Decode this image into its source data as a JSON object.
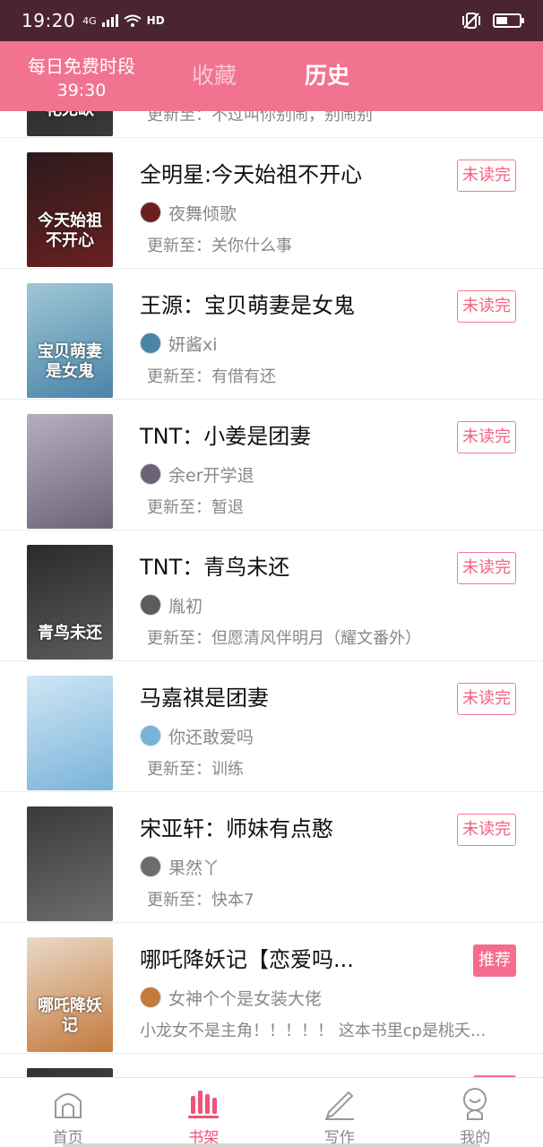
{
  "status_bar": {
    "time": "19:20",
    "network": "4G",
    "hd": "HD"
  },
  "header": {
    "free_label": "每日免费时段",
    "free_timer": "39:30",
    "tab_favorites": "收藏",
    "tab_history": "历史"
  },
  "books": [
    {
      "title": "",
      "author": "",
      "update": "更新至：不过叫你别闹，别闹别",
      "badge": "",
      "cover_text": "花无缺",
      "cover_colors": [
        "#1b1b1b",
        "#3a3a3a"
      ]
    },
    {
      "title": "全明星:今天始祖不开心",
      "author": "夜舞倾歌",
      "update": "更新至：关你什么事",
      "badge": "未读完",
      "cover_text": "今天始祖不开心",
      "cover_colors": [
        "#2b1a1c",
        "#6b2020"
      ]
    },
    {
      "title": "王源：宝贝萌妻是女鬼",
      "author": "妍酱xi",
      "update": "更新至：有借有还",
      "badge": "未读完",
      "cover_text": "宝贝萌妻是女鬼",
      "cover_colors": [
        "#9fc7d6",
        "#4a84a8"
      ]
    },
    {
      "title": "TNT：小姜是团妻",
      "author": "余er开学退",
      "update": "更新至：暂退",
      "badge": "未读完",
      "cover_text": "",
      "cover_colors": [
        "#b8aec0",
        "#6b6378"
      ]
    },
    {
      "title": "TNT：青鸟未还",
      "author": "胤初",
      "update": "更新至：但愿清风伴明月（耀文番外）",
      "badge": "未读完",
      "cover_text": "青鸟未还",
      "cover_colors": [
        "#2a2a2a",
        "#5c5c5c"
      ]
    },
    {
      "title": "马嘉祺是团妻",
      "author": "你还敢爱吗",
      "update": "更新至：训练",
      "badge": "未读完",
      "cover_text": "",
      "cover_colors": [
        "#cfe6f5",
        "#7ab3d9"
      ]
    },
    {
      "title": "宋亚轩：师妹有点憨",
      "author": "果然丫",
      "update": "更新至：快本7",
      "badge": "未读完",
      "cover_text": "",
      "cover_colors": [
        "#3a3a3a",
        "#6d6d6d"
      ]
    },
    {
      "title": "哪吒降妖记【恋爱吗...",
      "author": "女神个个是女装大佬",
      "update": "小龙女不是主角！！！！！ 这本书里cp是桃夭...",
      "badge": "推荐",
      "cover_text": "哪吒降妖记",
      "cover_colors": [
        "#e9d9c7",
        "#c47a3d"
      ]
    },
    {
      "title": "",
      "author": "",
      "update": "",
      "badge": "推荐",
      "cover_text": "",
      "cover_colors": [
        "#333",
        "#555"
      ]
    }
  ],
  "bottom_nav": [
    {
      "label": "首页",
      "icon": "home-icon"
    },
    {
      "label": "书架",
      "icon": "bookshelf-icon"
    },
    {
      "label": "写作",
      "icon": "pencil-icon"
    },
    {
      "label": "我的",
      "icon": "profile-icon"
    }
  ],
  "colors": {
    "accent": "#f17390",
    "status_bar": "#4a2530",
    "badge": "#f2607f"
  }
}
